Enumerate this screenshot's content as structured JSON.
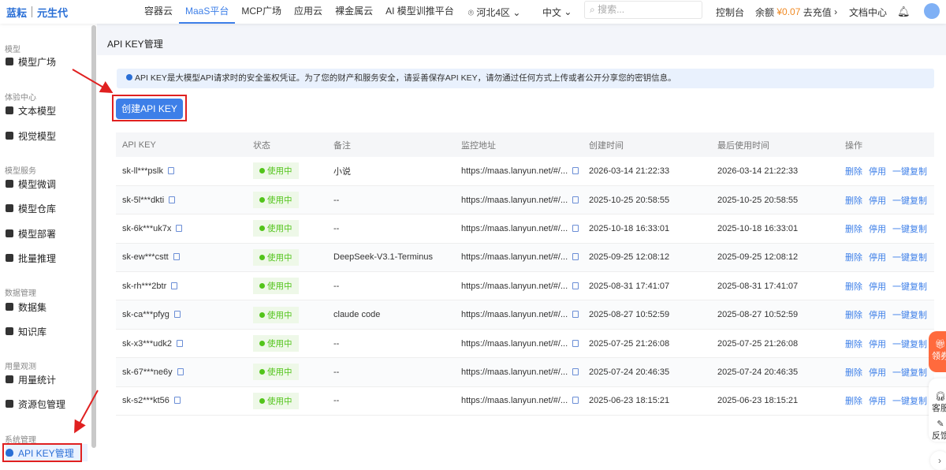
{
  "header": {
    "brand1": "蓝耘",
    "brand2": "元生代",
    "nav": [
      "容器云",
      "MaaS平台",
      "MCP广场",
      "应用云",
      "裸金属云",
      "AI 模型训推平台"
    ],
    "region": "河北4区",
    "lang": "中文",
    "search_placeholder": "搜索...",
    "console": "控制台",
    "balance_label": "余额",
    "balance": "¥0.07",
    "recharge": "去充值",
    "docs": "文档中心"
  },
  "sidebar": {
    "groups": [
      {
        "label": "模型",
        "items": [
          "模型广场"
        ]
      },
      {
        "label": "体验中心",
        "items": [
          "文本模型",
          "视觉模型"
        ]
      },
      {
        "label": "模型服务",
        "items": [
          "模型微调",
          "模型仓库",
          "模型部署",
          "批量推理"
        ]
      },
      {
        "label": "数据管理",
        "items": [
          "数据集",
          "知识库"
        ]
      },
      {
        "label": "用量观测",
        "items": [
          "用量统计",
          "资源包管理"
        ]
      },
      {
        "label": "系统管理",
        "items": [
          "API KEY管理"
        ]
      }
    ]
  },
  "page": {
    "title": "API KEY管理",
    "info": "API KEY是大模型API请求时的安全鉴权凭证。为了您的财产和服务安全，请妥善保存API KEY，请勿通过任何方式上传或者公开分享您的密钥信息。",
    "create_button": "创建API KEY"
  },
  "table": {
    "headers": [
      "API KEY",
      "状态",
      "备注",
      "监控地址",
      "创建时间",
      "最后使用时间",
      "操作"
    ],
    "actions": [
      "删除",
      "停用",
      "一键复制"
    ],
    "rows": [
      {
        "key": "sk-ll***pslk",
        "status": "使用中",
        "note": "小说",
        "url": "https://maas.lanyun.net/#/...",
        "created": "2026-03-14 21:22:33",
        "last": "2026-03-14 21:22:33"
      },
      {
        "key": "sk-5l***dkti",
        "status": "使用中",
        "note": "--",
        "url": "https://maas.lanyun.net/#/...",
        "created": "2025-10-25 20:58:55",
        "last": "2025-10-25 20:58:55"
      },
      {
        "key": "sk-6k***uk7x",
        "status": "使用中",
        "note": "--",
        "url": "https://maas.lanyun.net/#/...",
        "created": "2025-10-18 16:33:01",
        "last": "2025-10-18 16:33:01"
      },
      {
        "key": "sk-ew***cstt",
        "status": "使用中",
        "note": "DeepSeek-V3.1-Terminus",
        "url": "https://maas.lanyun.net/#/...",
        "created": "2025-09-25 12:08:12",
        "last": "2025-09-25 12:08:12"
      },
      {
        "key": "sk-rh***2btr",
        "status": "使用中",
        "note": "--",
        "url": "https://maas.lanyun.net/#/...",
        "created": "2025-08-31 17:41:07",
        "last": "2025-08-31 17:41:07"
      },
      {
        "key": "sk-ca***pfyg",
        "status": "使用中",
        "note": "claude code",
        "url": "https://maas.lanyun.net/#/...",
        "created": "2025-08-27 10:52:59",
        "last": "2025-08-27 10:52:59"
      },
      {
        "key": "sk-x3***udk2",
        "status": "使用中",
        "note": "--",
        "url": "https://maas.lanyun.net/#/...",
        "created": "2025-07-25 21:26:08",
        "last": "2025-07-25 21:26:08"
      },
      {
        "key": "sk-67***ne6y",
        "status": "使用中",
        "note": "--",
        "url": "https://maas.lanyun.net/#/...",
        "created": "2025-07-24 20:46:35",
        "last": "2025-07-24 20:46:35"
      },
      {
        "key": "sk-s2***kt56",
        "status": "使用中",
        "note": "--",
        "url": "https://maas.lanyun.net/#/...",
        "created": "2025-06-23 18:15:21",
        "last": "2025-06-23 18:15:21"
      }
    ]
  },
  "float": {
    "coupon": "领券",
    "service": "客服",
    "feedback": "反馈"
  }
}
